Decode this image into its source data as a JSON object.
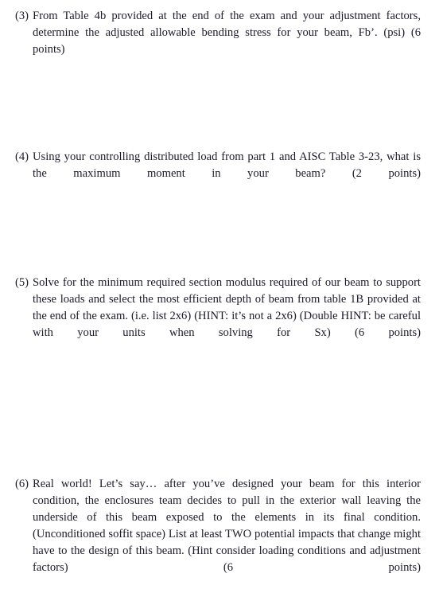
{
  "document": {
    "type": "exam-question-page",
    "background_color": "#ffffff",
    "text_color": "#1b1b2b"
  },
  "questions": [
    {
      "number": "(3)",
      "text": "From Table 4b provided at the end of the exam and your adjustment factors, determine the adjusted allowable bending stress for your beam, Fb’. (psi) (6 points)",
      "points": "6 points"
    },
    {
      "number": "(4)",
      "text": "Using your controlling distributed load from part 1 and AISC Table 3-23, what is the maximum moment in your beam? (2 points)",
      "points": "2 points"
    },
    {
      "number": "(5)",
      "text": "Solve for the minimum required section modulus required of our beam to support these loads and select the most efficient depth of beam from table 1B provided at the end of the exam. (i.e. list 2x6) (HINT: it’s not a 2x6) (Double HINT: be careful with your units when solving for Sx) (6 points)",
      "points": "6 points"
    },
    {
      "number": "(6)",
      "text": "Real world! Let’s say… after you’ve designed your beam for this interior condition, the enclosures team decides to pull in the exterior wall leaving the underside of this beam exposed to the elements in its final condition. (Unconditioned soffit space) List at least TWO potential impacts that change might have to the design of this beam. (Hint consider loading conditions and adjustment factors) (6 points)",
      "points": "6 points"
    }
  ]
}
